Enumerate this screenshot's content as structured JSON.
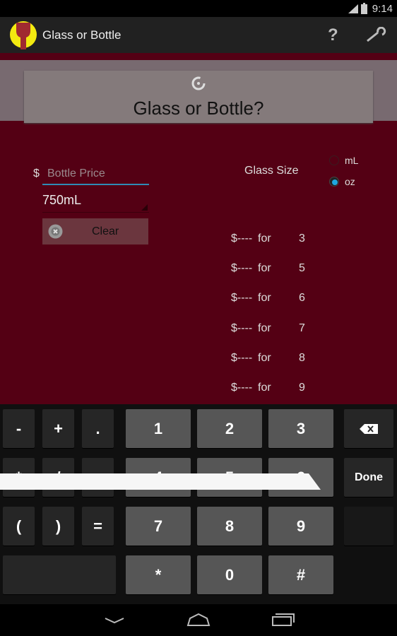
{
  "status": {
    "time": "9:14"
  },
  "actionbar": {
    "title": "Glass or Bottle",
    "help_icon": "question-icon",
    "settings_icon": "wrench-icon"
  },
  "main": {
    "calc_button": "Glass or Bottle?",
    "currency": "$",
    "price_placeholder": "Bottle Price",
    "price_value": "",
    "bottle_size": "750mL",
    "clear_label": "Clear",
    "glass_size_label": "Glass Size",
    "units": [
      {
        "label": "mL",
        "selected": false
      },
      {
        "label": "oz",
        "selected": true
      }
    ],
    "results": [
      {
        "price": "$----",
        "for": "for",
        "size": "3"
      },
      {
        "price": "$----",
        "for": "for",
        "size": "5"
      },
      {
        "price": "$----",
        "for": "for",
        "size": "6"
      },
      {
        "price": "$----",
        "for": "for",
        "size": "7"
      },
      {
        "price": "$----",
        "for": "for",
        "size": "8"
      },
      {
        "price": "$----",
        "for": "for",
        "size": "9"
      }
    ]
  },
  "keyboard": {
    "keys": [
      [
        "-",
        "+",
        ".",
        "1",
        "2",
        "3"
      ],
      [
        "*",
        "/",
        ",",
        "4",
        "5",
        "6"
      ],
      [
        "(",
        ")",
        "=",
        "7",
        "8",
        "9"
      ],
      [
        "",
        "*",
        "0",
        "#"
      ]
    ],
    "done": "Done",
    "backspace_icon": "backspace-icon"
  },
  "colors": {
    "accent": "#1fa8e0",
    "content_bg": "#540014"
  }
}
